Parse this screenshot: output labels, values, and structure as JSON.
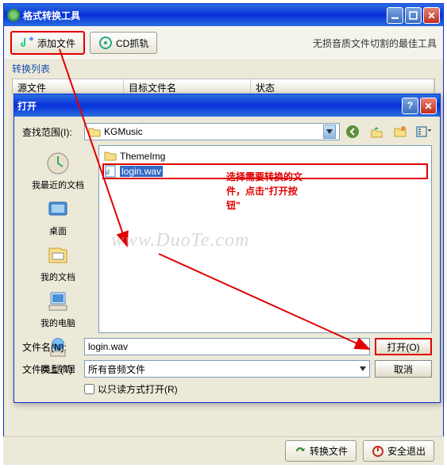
{
  "main": {
    "title": "格式转换工具",
    "toolbar": {
      "add_file": "添加文件",
      "cd_grab": "CD抓轨",
      "right_text": "无损音质文件切割的最佳工具"
    },
    "sub_label": "转换列表",
    "columns": {
      "source": "源文件",
      "target": "目标文件名",
      "status": "状态"
    }
  },
  "dialog": {
    "title": "打开",
    "look_in_label": "查找范围(I):",
    "look_in_value": "KGMusic",
    "places": {
      "recent": "我最近的文档",
      "desktop": "桌面",
      "mydocs": "我的文档",
      "mycomputer": "我的电脑",
      "network": "网上邻居"
    },
    "files": {
      "folder": "ThemeImg",
      "selected": "login.wav"
    },
    "annotation_l1": "选择需要转换的文",
    "annotation_l2": "件，点击\"打开按",
    "annotation_l3": "钮\"",
    "filename_label": "文件名(N):",
    "filename_value": "login.wav",
    "filetype_label": "文件类型(T):",
    "filetype_value": "所有音频文件",
    "readonly_label": "以只读方式打开(R)",
    "open_btn": "打开(O)",
    "cancel_btn": "取消"
  },
  "footer": {
    "convert": "转换文件",
    "exit": "安全退出"
  },
  "watermark": "www.DuoTe.com"
}
